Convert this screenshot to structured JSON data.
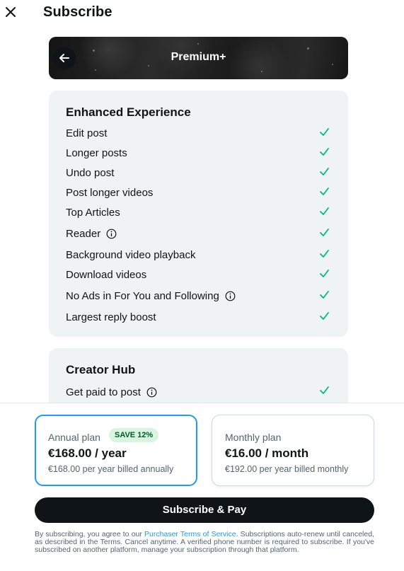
{
  "header": {
    "title": "Subscribe",
    "close_icon": "close-icon"
  },
  "hero": {
    "title": "Premium+",
    "back_icon": "arrow-left-icon"
  },
  "enhanced": {
    "title": "Enhanced Experience",
    "features": [
      {
        "label": "Edit post",
        "info": false
      },
      {
        "label": "Longer posts",
        "info": false
      },
      {
        "label": "Undo post",
        "info": false
      },
      {
        "label": "Post longer videos",
        "info": false
      },
      {
        "label": "Top Articles",
        "info": false
      },
      {
        "label": "Reader",
        "info": true
      },
      {
        "label": "Background video playback",
        "info": false
      },
      {
        "label": "Download videos",
        "info": false
      },
      {
        "label": "No Ads in For You and Following",
        "info": true
      },
      {
        "label": "Largest reply boost",
        "info": false
      }
    ]
  },
  "creator_hub": {
    "title": "Creator Hub",
    "features": [
      {
        "label": "Get paid to post",
        "info": true
      }
    ]
  },
  "plans": {
    "annual": {
      "name": "Annual plan",
      "badge": "SAVE 12%",
      "price": "€168.00 / year",
      "sub": "€168.00 per year billed annually",
      "selected": true
    },
    "monthly": {
      "name": "Monthly plan",
      "price": "€16.00 / month",
      "sub": "€192.00 per year billed monthly",
      "selected": false
    }
  },
  "subscribe_button": "Subscribe & Pay",
  "legal": {
    "before": "By subscribing, you agree to our ",
    "link": "Purchaser Terms of Service",
    "after": ". Subscriptions auto-renew until canceled, as described in the Terms. Cancel anytime. A verified phone number is required to subscribe. If you've subscribed on another platform, manage your subscription through that platform."
  },
  "colors": {
    "accent": "#1d9bf0",
    "check": "#00ba7c",
    "text": "#0f1419",
    "muted": "#536471",
    "card_bg": "#eff3f4"
  }
}
